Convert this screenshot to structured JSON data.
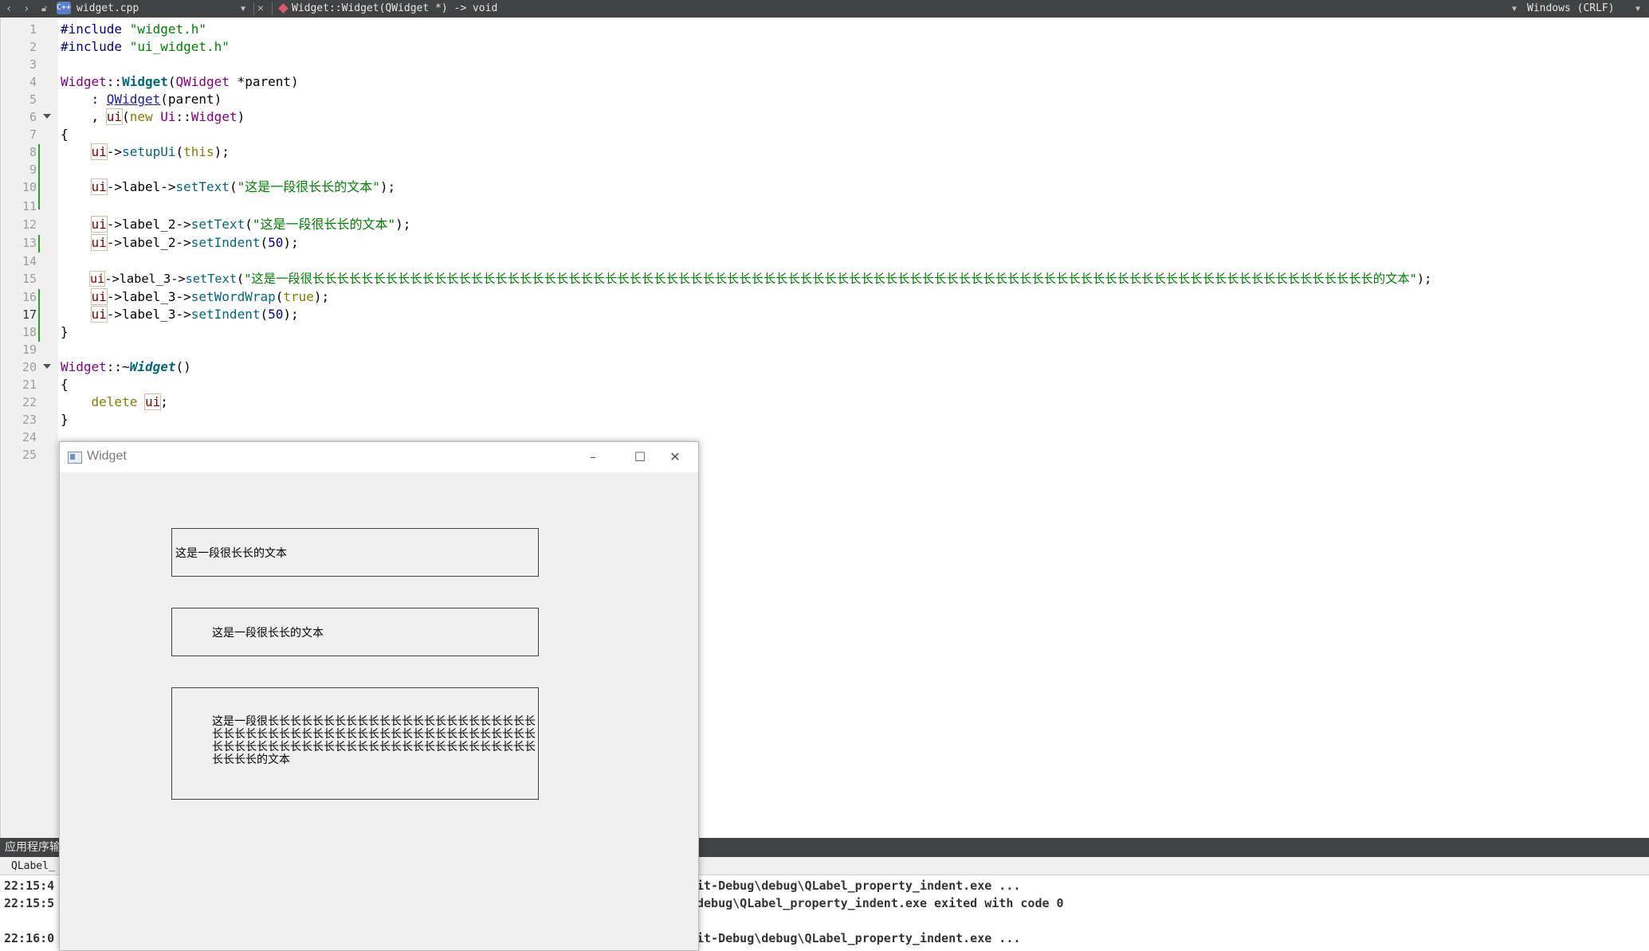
{
  "toolbar": {
    "file_name": "widget.cpp",
    "function_signature": "Widget::Widget(QWidget *) -> void",
    "line_ending": "Windows (CRLF)",
    "file_badge": "C++"
  },
  "editor": {
    "line_numbers": [
      "1",
      "2",
      "3",
      "4",
      "5",
      "6",
      "7",
      "8",
      "9",
      "10",
      "11",
      "12",
      "13",
      "14",
      "15",
      "16",
      "17",
      "18",
      "19",
      "20",
      "21",
      "22",
      "23",
      "24",
      "25"
    ],
    "current_line": "17",
    "code": {
      "l1_directive": "#include",
      "l1_str": "\"widget.h\"",
      "l2_directive": "#include",
      "l2_str": "\"ui_widget.h\"",
      "cls_widget": "Widget",
      "scope": "::",
      "ctor_name": "Widget",
      "qwidget": "QWidget",
      "param": " *parent)",
      "open_paren": "(",
      "init_colon": "    : ",
      "init_qwidget": "QWidget",
      "init_parent": "(parent)",
      "init_comma": "    , ",
      "ui": "ui",
      "new_kw": "new",
      "ui_ns": "Ui",
      "brace_open": "{",
      "brace_close": "}",
      "arrow": "->",
      "setup_ui": "setupUi",
      "this_kw": "this",
      "label": "label",
      "label_2": "label_2",
      "label_3": "label_3",
      "set_text": "setText",
      "set_indent": "setIndent",
      "set_word_wrap": "setWordWrap",
      "true_kw": "true",
      "num_50": "50",
      "short_text": "\"这是一段很长长的文本\"",
      "long_text": "\"这是一段很长长长长长长长长长长长长长长长长长长长长长长长长长长长长长长长长长长长长长长长长长长长长长长长长长长长长长长长长长长长长长长长长长长长长长长长长长长长长长长长长长长长长长长长的文本\"",
      "dtor_tilde": "::~",
      "dtor_name": "Widget",
      "empty_call": "()",
      "delete_kw": "delete",
      "semicolon": ";",
      "close_semicolon": ");"
    }
  },
  "widget_window": {
    "title": "Widget",
    "minimize": "–",
    "maximize": "☐",
    "close": "✕",
    "label1_text": "这是一段很长长的文本",
    "label2_text": "这是一段很长长的文本",
    "label3_text": "这是一段很长长长长长长长长长长长长长长长长长长长长长长长长长长长长长长长长长长长长长长长长长长长长长长长长长长长长长长长长长长长长长长长长长长长长长长长长长长长长长长长长长长长长长长的文本"
  },
  "output": {
    "title": "应用程序输",
    "tab": "QLabel_",
    "lines": [
      {
        "time": "22:15:4",
        "text": "it-Debug\\debug\\QLabel_property_indent.exe ..."
      },
      {
        "time": "22:15:5",
        "text": "debug\\QLabel_property_indent.exe exited with code 0"
      },
      {
        "time": "22:16:0",
        "text": "it-Debug\\debug\\QLabel_property_indent.exe ..."
      }
    ]
  }
}
